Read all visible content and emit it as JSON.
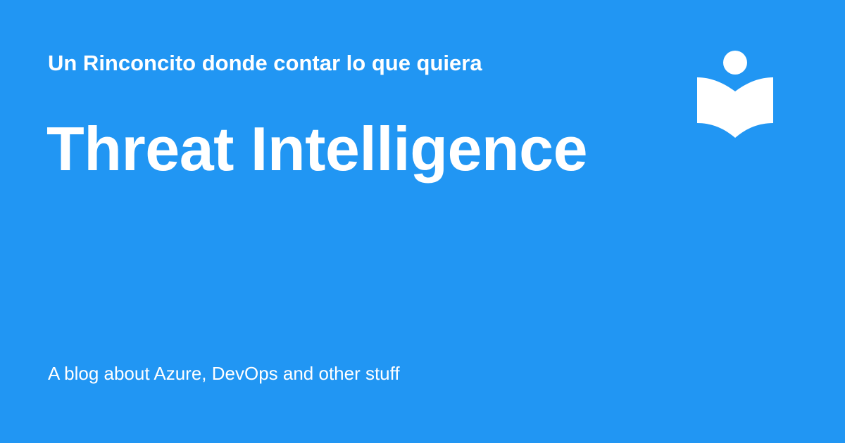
{
  "site": {
    "title": "Un Rinconcito donde contar lo que quiera",
    "tagline": "A blog about Azure, DevOps and other stuff",
    "logo_icon": "reader-book-icon"
  },
  "page": {
    "title": "Threat Intelligence"
  },
  "colors": {
    "background": "#2196f3",
    "text": "#ffffff"
  }
}
